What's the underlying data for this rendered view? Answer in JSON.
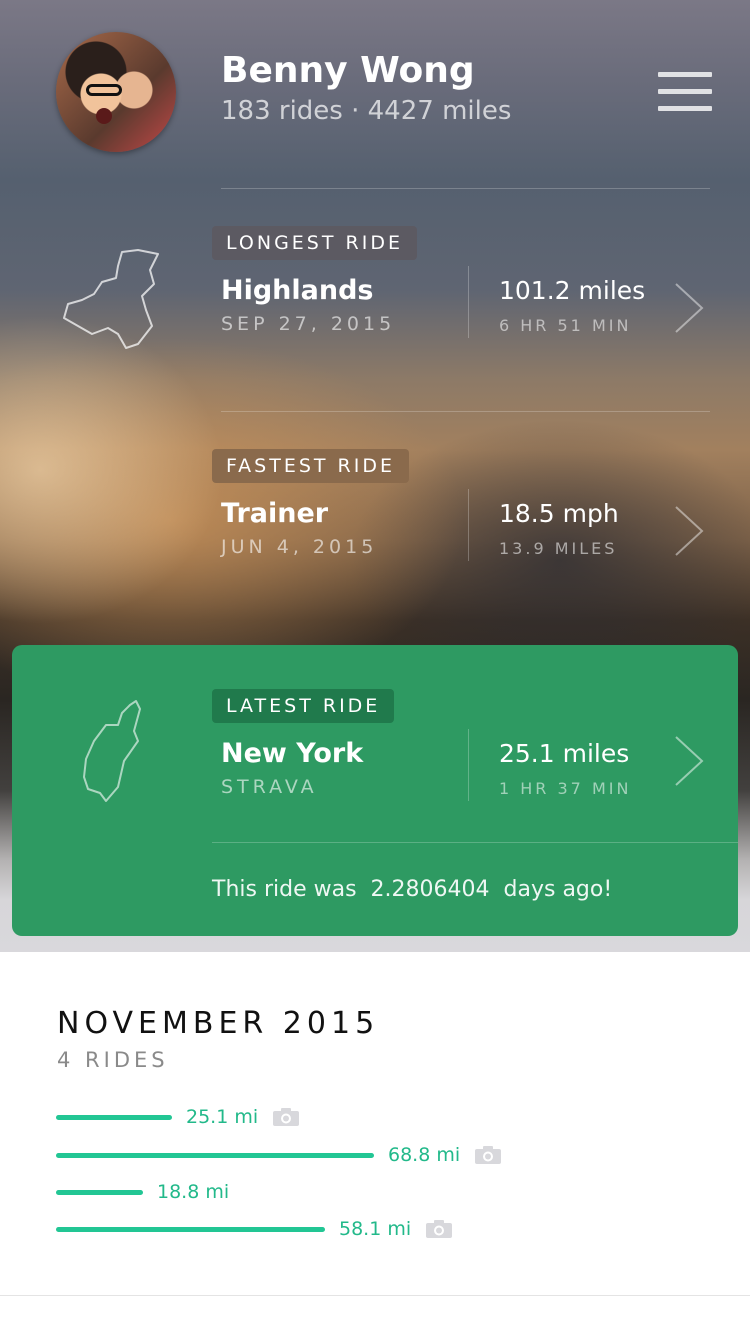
{
  "profile": {
    "name": "Benny Wong",
    "stats": "183 rides · 4427 miles"
  },
  "longest": {
    "badge": "LONGEST RIDE",
    "title": "Highlands",
    "date": "SEP 27, 2015",
    "metric": "101.2 miles",
    "metric_sub": "6 HR 51 MIN",
    "badge_color": "#5c5a62"
  },
  "fastest": {
    "badge": "FASTEST RIDE",
    "title": "Trainer",
    "date": "JUN 4, 2015",
    "metric": "18.5 mph",
    "metric_sub": "13.9 MILES",
    "badge_color": "#8a6a4c"
  },
  "latest": {
    "badge": "LATEST RIDE",
    "title": "New York",
    "source": "STRAVA",
    "metric": "25.1 miles",
    "metric_sub": "1 HR 37 MIN",
    "ago_prefix": "This ride was",
    "ago_value": "2.2806404",
    "ago_suffix": "days ago!",
    "card_color": "#2e9a62",
    "badge_color": "#207a4c"
  },
  "month": {
    "title": "NOVEMBER 2015",
    "count": "4 RIDES",
    "bar_color": "#22c694",
    "rides": [
      {
        "distance": "25.1 mi",
        "miles": 25.1,
        "photo": true
      },
      {
        "distance": "68.8 mi",
        "miles": 68.8,
        "photo": true
      },
      {
        "distance": "18.8 mi",
        "miles": 18.8,
        "photo": false
      },
      {
        "distance": "58.1 mi",
        "miles": 58.1,
        "photo": true
      }
    ]
  }
}
